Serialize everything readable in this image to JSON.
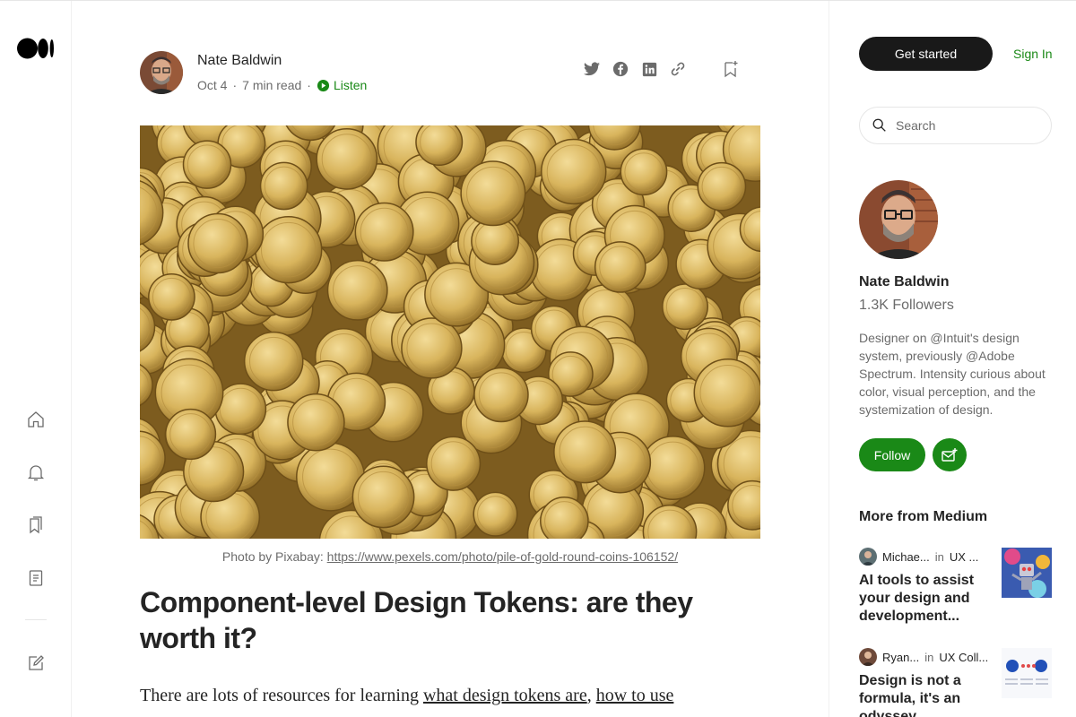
{
  "author": {
    "name": "Nate Baldwin",
    "date": "Oct 4",
    "read_time": "7 min read",
    "listen_label": "Listen"
  },
  "share_icons": [
    "twitter-icon",
    "facebook-icon",
    "linkedin-icon",
    "link-icon"
  ],
  "article": {
    "caption_prefix": "Photo by Pixabay:",
    "caption_link": "https://www.pexels.com/photo/pile-of-gold-round-coins-106152/",
    "title": "Component-level Design Tokens: are they worth it?",
    "body_start": "There are lots of resources for learning",
    "link1": "what design tokens are",
    "comma": ",",
    "link2": "how to use"
  },
  "sidebar": {
    "get_started": "Get started",
    "sign_in": "Sign In",
    "search_placeholder": "Search",
    "profile": {
      "name": "Nate Baldwin",
      "followers": "1.3K Followers",
      "bio": "Designer on @Intuit's design system, previously @Adobe Spectrum. Intensity curious about color, visual perception, and the systemization of design.",
      "follow_label": "Follow"
    },
    "more_title": "More from Medium",
    "recommendations": [
      {
        "author": "Michae...",
        "in": "in",
        "pub": "UX ...",
        "title": "AI tools to assist your design and development..."
      },
      {
        "author": "Ryan...",
        "in": "in",
        "pub": "UX Coll...",
        "title": "Design is not a formula, it's an odyssey"
      }
    ]
  },
  "colors": {
    "accent_green": "#1a8917",
    "text_dark": "#242424",
    "text_muted": "#6b6b6b"
  }
}
